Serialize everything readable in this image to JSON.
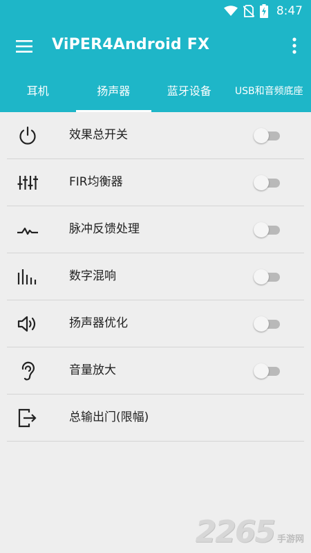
{
  "status_bar": {
    "time": "8:47",
    "icons": [
      "wifi-icon",
      "no-sim-icon",
      "battery-charging-icon"
    ]
  },
  "app_bar": {
    "title": "ViPER4Android FX",
    "menu_icon": "hamburger-menu-icon",
    "overflow_icon": "more-vert-icon"
  },
  "tabs": [
    {
      "label": "耳机",
      "selected": false
    },
    {
      "label": "扬声器",
      "selected": true
    },
    {
      "label": "蓝牙设备",
      "selected": false
    },
    {
      "label": "USB和音频底座",
      "selected": false
    }
  ],
  "items": [
    {
      "label": "效果总开关",
      "icon": "power-icon",
      "has_switch": true,
      "switch_on": false
    },
    {
      "label": "FIR均衡器",
      "icon": "equalizer-sliders-icon",
      "has_switch": true,
      "switch_on": false
    },
    {
      "label": "脉冲反馈处理",
      "icon": "pulse-icon",
      "has_switch": true,
      "switch_on": false
    },
    {
      "label": "数字混响",
      "icon": "reverb-bars-icon",
      "has_switch": true,
      "switch_on": false
    },
    {
      "label": "扬声器优化",
      "icon": "speaker-icon",
      "has_switch": true,
      "switch_on": false
    },
    {
      "label": "音量放大",
      "icon": "ear-icon",
      "has_switch": true,
      "switch_on": false
    },
    {
      "label": "总输出门(限幅)",
      "icon": "exit-icon",
      "has_switch": false
    }
  ],
  "watermark": {
    "number": "2265",
    "text": "手游网"
  },
  "colors": {
    "accent": "#1eb6c8",
    "background": "#eeeeee",
    "switch_track_off": "#b9b9b9",
    "switch_thumb_off": "#f5f5f5"
  }
}
